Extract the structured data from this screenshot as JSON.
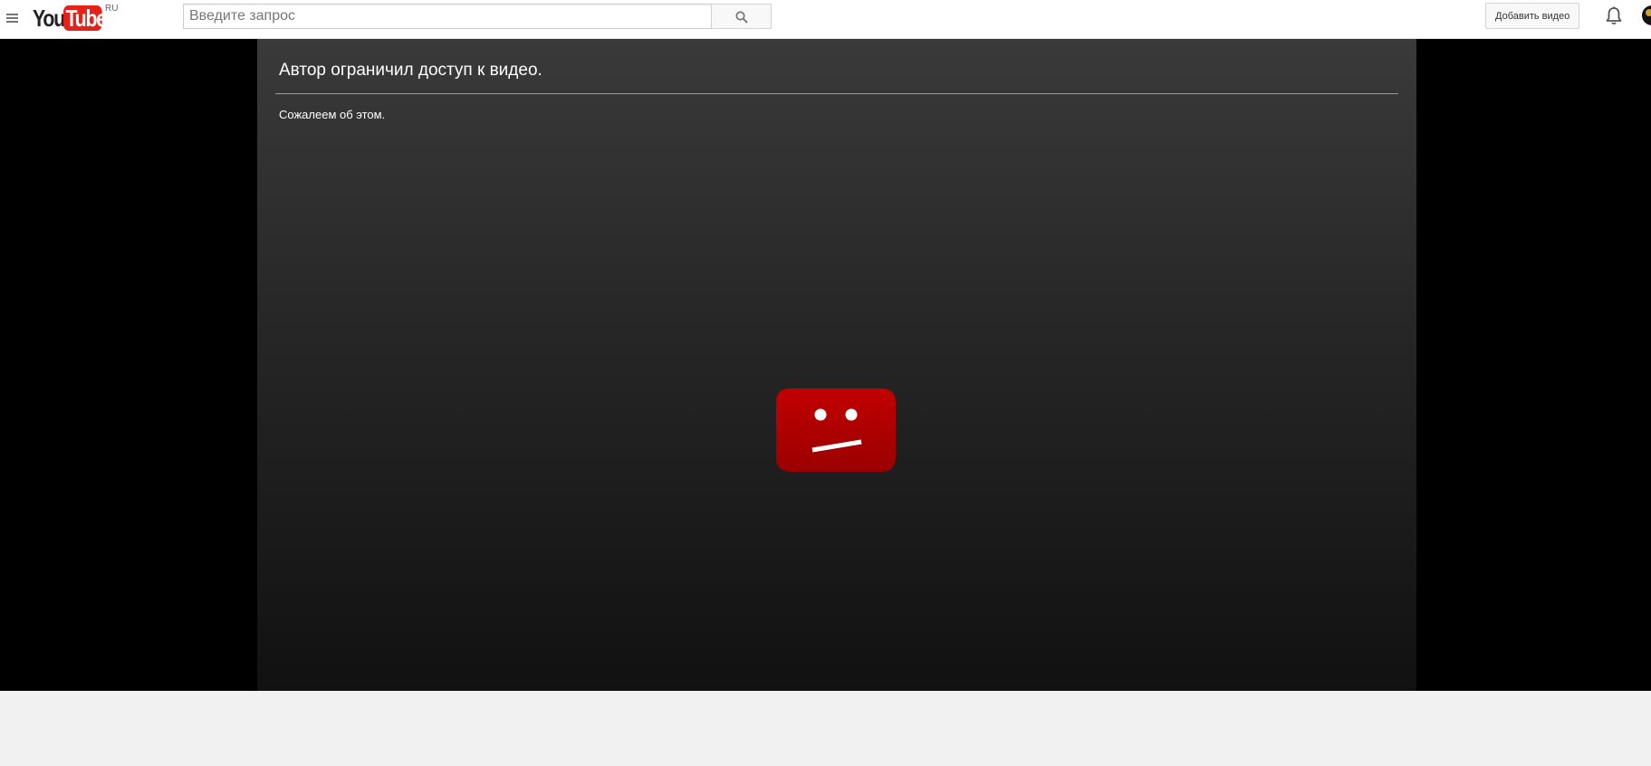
{
  "masthead": {
    "logo": {
      "part_you": "You",
      "part_tube": "Tube",
      "region": "RU"
    },
    "search": {
      "placeholder": "Введите запрос",
      "value": ""
    },
    "upload_label": "Добавить видео",
    "icons": {
      "menu": "menu-icon",
      "search": "search-icon",
      "notifications": "bell-icon",
      "avatar": "avatar"
    }
  },
  "player": {
    "error_title": "Автор ограничил доступ к видео.",
    "error_subtitle": "Сожалеем об этом.",
    "icon": "sad-face-icon"
  },
  "colors": {
    "brand_red": "#e62117",
    "error_icon_red": "#b00000",
    "player_background": "#000000",
    "page_background": "#f1f1f1"
  }
}
